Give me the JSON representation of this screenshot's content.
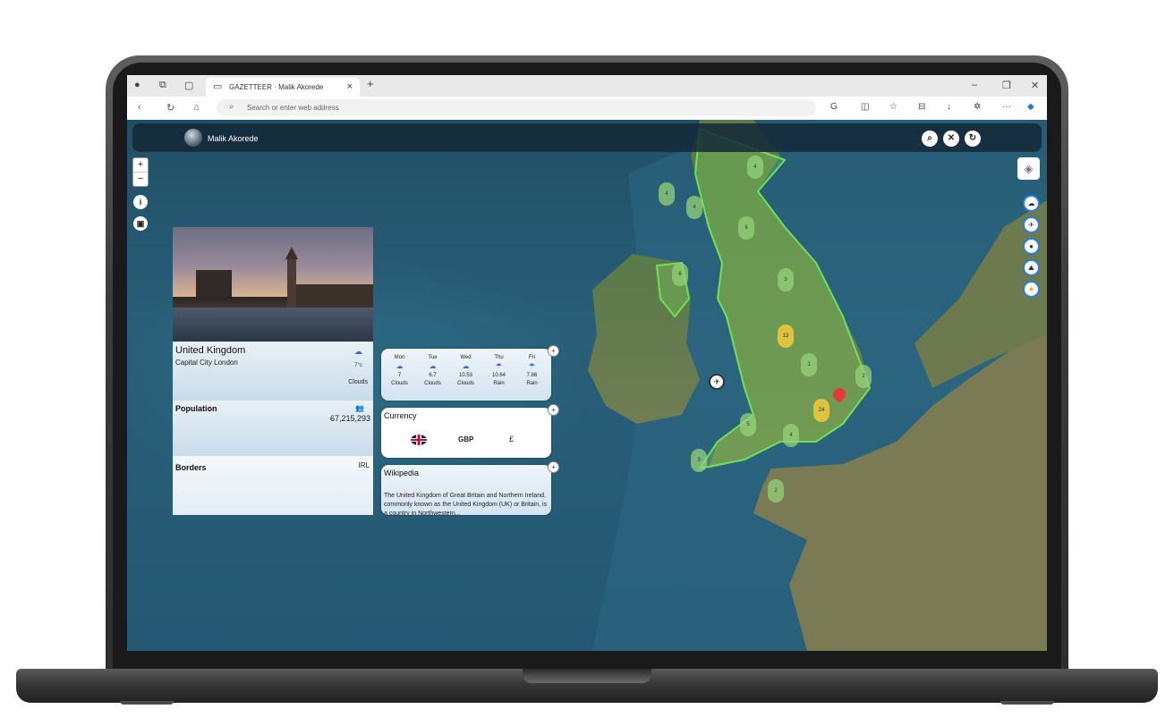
{
  "browser": {
    "tab_title": "GAZETTEER · Malik Akorede",
    "address_placeholder": "Search or enter web address"
  },
  "app": {
    "user_name": "Malik Akorede",
    "top_buttons": [
      "search-icon",
      "close-icon",
      "refresh-icon"
    ]
  },
  "map": {
    "zoom_in": "+",
    "zoom_out": "−",
    "clusters": [
      {
        "count": "4"
      },
      {
        "count": "4"
      },
      {
        "count": "4"
      },
      {
        "count": "6"
      },
      {
        "count": "6"
      },
      {
        "count": "3"
      },
      {
        "count": "13"
      },
      {
        "count": "1"
      },
      {
        "count": "2"
      },
      {
        "count": "24"
      },
      {
        "count": "5"
      },
      {
        "count": "4"
      },
      {
        "count": "3"
      },
      {
        "count": "2"
      }
    ]
  },
  "country": {
    "name": "United Kingdom",
    "capital": "Capital City London",
    "temperature": "7°c",
    "weather": "Clouds",
    "population_label": "Population",
    "population": "67,215,293",
    "borders_label": "Borders",
    "borders": "IRL"
  },
  "forecast": [
    {
      "day": "Mon",
      "temp": "7",
      "desc": "Clouds"
    },
    {
      "day": "Tue",
      "temp": "6.7",
      "desc": "Clouds"
    },
    {
      "day": "Wed",
      "temp": "10.53",
      "desc": "Clouds"
    },
    {
      "day": "Thu",
      "temp": "10.64",
      "desc": "Rain"
    },
    {
      "day": "Fri",
      "temp": "7.86",
      "desc": "Rain"
    }
  ],
  "currency": {
    "title": "Currency",
    "code": "GBP",
    "symbol": "£"
  },
  "wikipedia": {
    "title": "Wikipedia",
    "text": "The United Kingdom of Great Britain and Northern Ireland, commonly known as the United Kingdom (UK) or Britain, is a country in Northwestern..."
  }
}
